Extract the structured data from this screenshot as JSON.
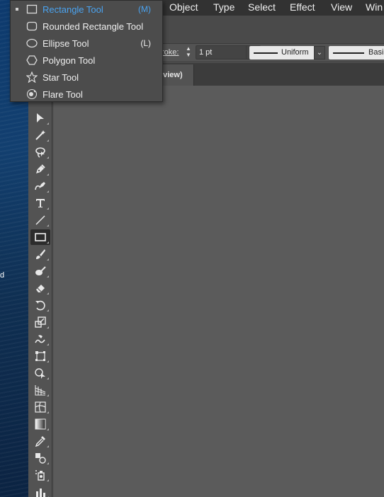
{
  "menubar": {
    "items": [
      "Object",
      "Type",
      "Select",
      "Effect",
      "View",
      "Win"
    ]
  },
  "control_bar": {
    "stroke_label": "roke:",
    "stroke_weight": "1 pt",
    "profile_label": "Uniform",
    "brush_label": "Basi"
  },
  "document_tab": {
    "label": "eview)"
  },
  "desktop": {
    "glyph": "d"
  },
  "flyout": {
    "items": [
      {
        "label": "Rectangle Tool",
        "shortcut": "(M)",
        "icon": "rectangle-icon",
        "selected": true
      },
      {
        "label": "Rounded Rectangle Tool",
        "shortcut": "",
        "icon": "rounded-rectangle-icon",
        "selected": false
      },
      {
        "label": "Ellipse Tool",
        "shortcut": "(L)",
        "icon": "ellipse-icon",
        "selected": false
      },
      {
        "label": "Polygon Tool",
        "shortcut": "",
        "icon": "polygon-icon",
        "selected": false
      },
      {
        "label": "Star Tool",
        "shortcut": "",
        "icon": "star-icon",
        "selected": false
      },
      {
        "label": "Flare Tool",
        "shortcut": "",
        "icon": "flare-icon",
        "selected": false
      }
    ]
  },
  "tools": [
    "direct-selection-tool-icon",
    "magic-wand-tool-icon",
    "lasso-tool-icon",
    "pen-tool-icon",
    "curvature-tool-icon",
    "type-tool-icon",
    "line-segment-tool-icon",
    "rectangle-tool-icon",
    "paintbrush-tool-icon",
    "shaper-tool-icon",
    "eraser-tool-icon",
    "rotate-tool-icon",
    "scale-tool-icon",
    "warp-tool-icon",
    "free-transform-tool-icon",
    "shape-builder-tool-icon",
    "perspective-grid-tool-icon",
    "mesh-tool-icon",
    "gradient-tool-icon",
    "eyedropper-tool-icon",
    "blend-tool-icon",
    "symbol-sprayer-tool-icon",
    "column-graph-tool-icon"
  ],
  "colors": {
    "selected_text": "#4aa3f0",
    "panel": "#535353",
    "canvas": "#5b5b5b",
    "menubar": "#323232"
  }
}
